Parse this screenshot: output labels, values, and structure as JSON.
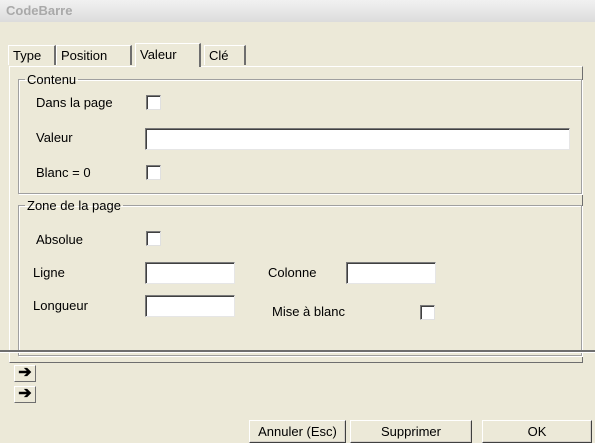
{
  "window": {
    "title": "CodeBarre"
  },
  "tabs": [
    {
      "label": "Type",
      "active": false
    },
    {
      "label": "Position",
      "active": false
    },
    {
      "label": "Valeur",
      "active": true
    },
    {
      "label": "Clé",
      "active": false
    }
  ],
  "contenu": {
    "legend": "Contenu",
    "dans_la_page": {
      "label": "Dans la page",
      "checked": false
    },
    "valeur": {
      "label": "Valeur",
      "value": ""
    },
    "blanc_zero": {
      "label": "Blanc = 0",
      "checked": false
    }
  },
  "zone": {
    "legend": "Zone de la page",
    "absolue": {
      "label": "Absolue",
      "checked": false
    },
    "ligne": {
      "label": "Ligne",
      "value": ""
    },
    "colonne": {
      "label": "Colonne",
      "value": ""
    },
    "longueur": {
      "label": "Longueur",
      "value": ""
    },
    "mise_a_blanc": {
      "label": "Mise à blanc",
      "checked": false
    }
  },
  "nav": {
    "arrow_icon": "right-arrow-icon",
    "glyph": "➔"
  },
  "buttons": {
    "cancel": "Annuler (Esc)",
    "delete": "Supprimer",
    "ok": "OK"
  }
}
